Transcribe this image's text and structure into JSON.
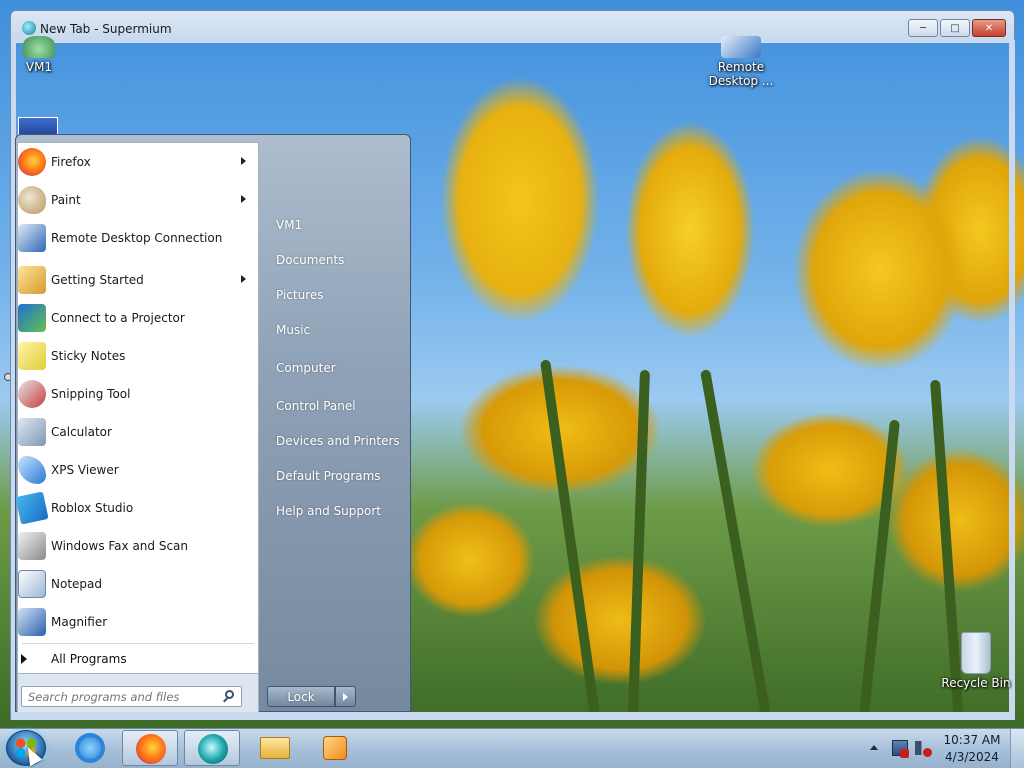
{
  "window": {
    "title": "New Tab - Supermium",
    "buttons": {
      "minimize": "─",
      "maximize": "□",
      "close": "✕"
    }
  },
  "desktop_icons": {
    "vm1": "VM1",
    "remote_desktop": "Remote\nDesktop ...",
    "recycle_bin": "Recycle Bin"
  },
  "start_menu": {
    "programs": [
      {
        "label": "Firefox",
        "icon": "firefox-icon",
        "has_submenu": true
      },
      {
        "label": "Paint",
        "icon": "paint-icon",
        "has_submenu": true
      },
      {
        "label": "Remote Desktop Connection",
        "icon": "remote-desktop-icon",
        "has_submenu": false
      },
      {
        "label": "Getting Started",
        "icon": "getting-started-icon",
        "has_submenu": true
      },
      {
        "label": "Connect to a Projector",
        "icon": "projector-icon",
        "has_submenu": false
      },
      {
        "label": "Sticky Notes",
        "icon": "sticky-notes-icon",
        "has_submenu": false
      },
      {
        "label": "Snipping Tool",
        "icon": "snipping-tool-icon",
        "has_submenu": false
      },
      {
        "label": "Calculator",
        "icon": "calculator-icon",
        "has_submenu": false
      },
      {
        "label": "XPS Viewer",
        "icon": "xps-viewer-icon",
        "has_submenu": false
      },
      {
        "label": "Roblox Studio",
        "icon": "roblox-studio-icon",
        "has_submenu": false
      },
      {
        "label": "Windows Fax and Scan",
        "icon": "fax-scan-icon",
        "has_submenu": false
      },
      {
        "label": "Notepad",
        "icon": "notepad-icon",
        "has_submenu": false
      },
      {
        "label": "Magnifier",
        "icon": "magnifier-icon",
        "has_submenu": false
      }
    ],
    "all_programs": "All Programs",
    "search_placeholder": "Search programs and files",
    "places": [
      "VM1",
      "Documents",
      "Pictures",
      "Music",
      "Computer",
      "Control Panel",
      "Devices and Printers",
      "Default Programs",
      "Help and Support"
    ],
    "lock_label": "Lock"
  },
  "taskbar": {
    "pinned": [
      "internet-explorer-icon",
      "firefox-icon",
      "supermium-icon",
      "windows-explorer-icon",
      "media-player-icon"
    ],
    "clock": {
      "time": "10:37 AM",
      "date": "4/3/2024"
    }
  },
  "colors": {
    "start_menu_right": "#8fa2b7",
    "taskbar": "#a8c1d9",
    "close_button": "#c4402a"
  }
}
